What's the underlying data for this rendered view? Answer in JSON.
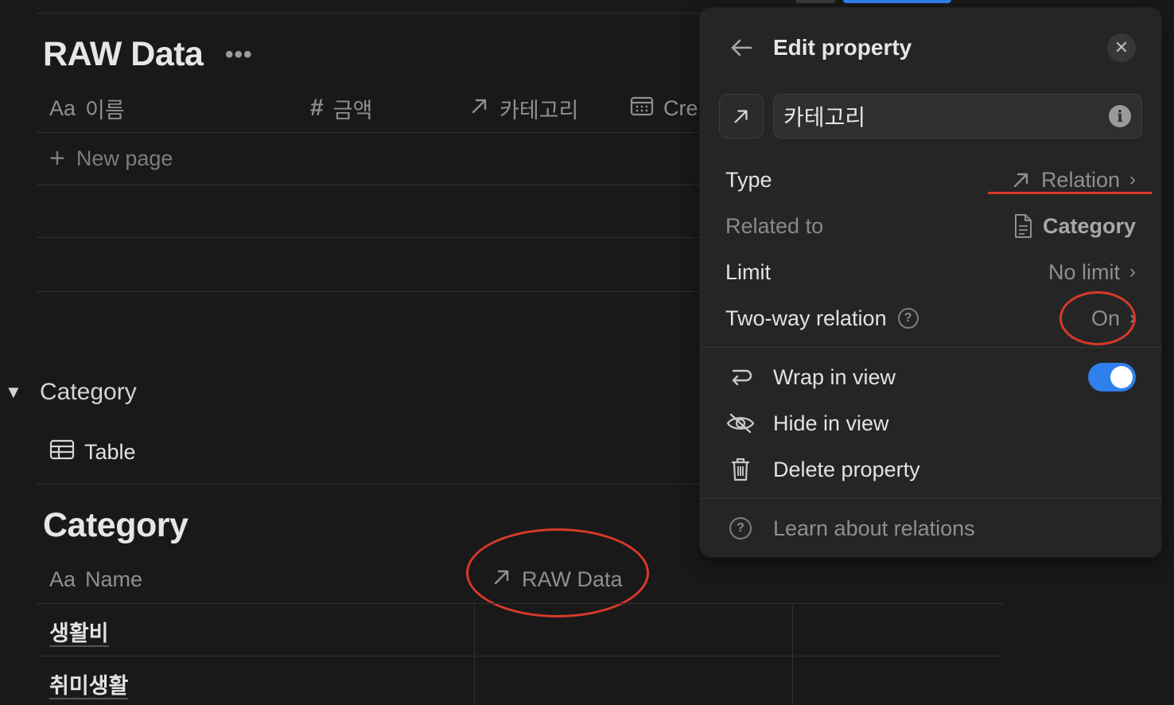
{
  "raw_db": {
    "title": "RAW Data",
    "more": "•••",
    "columns": [
      {
        "icon": "Aa",
        "label": "이름"
      },
      {
        "icon": "#",
        "label": "금액"
      },
      {
        "icon": "↗",
        "label": "카테고리"
      },
      {
        "icon": "calendar",
        "label": "Cre"
      }
    ],
    "new_page_plus": "+",
    "new_page_label": "New page"
  },
  "category_section": {
    "toggle": "▼",
    "title": "Category",
    "view_tab": "Table",
    "db_title": "Category",
    "columns": [
      {
        "icon": "Aa",
        "label": "Name"
      },
      {
        "icon": "↗",
        "label": "RAW Data"
      }
    ],
    "rows": [
      "생활비",
      "취미생활"
    ]
  },
  "popover": {
    "back": "←",
    "title": "Edit property",
    "close": "✕",
    "property_name": "카테고리",
    "info": "i",
    "type_label": "Type",
    "type_value": "Relation",
    "related_to_label": "Related to",
    "related_to_value": "Category",
    "limit_label": "Limit",
    "limit_value": "No limit",
    "two_way_label": "Two-way relation",
    "two_way_help": "?",
    "two_way_value": "On",
    "chevron": "›",
    "wrap_label": "Wrap in view",
    "wrap_on": true,
    "hide_label": "Hide in view",
    "delete_label": "Delete property",
    "learn_label": "Learn about relations",
    "learn_help": "?"
  },
  "colors": {
    "background": "#191919",
    "popover": "#252525",
    "annotation_red": "#d8392b",
    "toggle_blue": "#2f80ed"
  }
}
